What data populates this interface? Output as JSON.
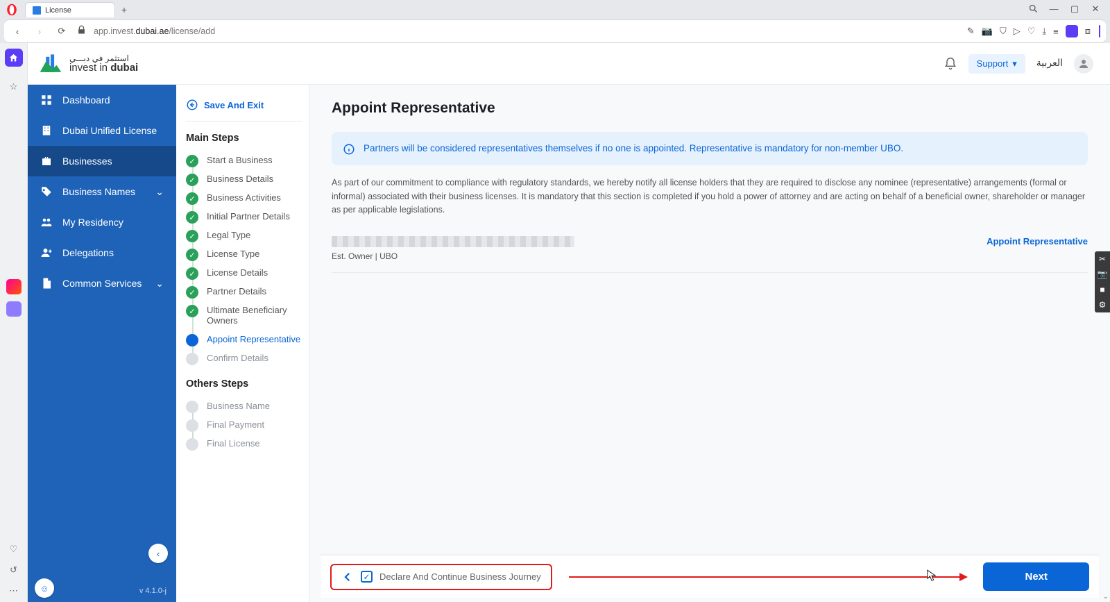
{
  "browser": {
    "tab_title": "License",
    "url_prefix": "app.invest.",
    "url_mid": "dubai.ae",
    "url_suffix": "/license/add"
  },
  "header": {
    "logo_ar": "استثمر في دبـــي",
    "logo_en_1": "invest in ",
    "logo_en_2": "dubai",
    "support": "Support",
    "language": "العربية"
  },
  "sidebar": {
    "items": [
      {
        "label": "Dashboard"
      },
      {
        "label": "Dubai Unified License"
      },
      {
        "label": "Businesses"
      },
      {
        "label": "Business Names"
      },
      {
        "label": "My Residency"
      },
      {
        "label": "Delegations"
      },
      {
        "label": "Common Services"
      }
    ],
    "version": "v 4.1.0-j"
  },
  "steps": {
    "save_exit": "Save And Exit",
    "main_heading": "Main Steps",
    "main": [
      "Start a Business",
      "Business Details",
      "Business Activities",
      "Initial Partner Details",
      "Legal Type",
      "License Type",
      "License Details",
      "Partner Details",
      "Ultimate Beneficiary Owners",
      "Appoint Representative",
      "Confirm Details"
    ],
    "main_states": [
      "done",
      "done",
      "done",
      "done",
      "done",
      "done",
      "done",
      "done",
      "done",
      "current",
      "pending"
    ],
    "others_heading": "Others Steps",
    "others": [
      "Business Name",
      "Final Payment",
      "Final License"
    ]
  },
  "content": {
    "title": "Appoint Representative",
    "banner": "Partners will be considered representatives themselves if no one is appointed. Representative is mandatory for non-member UBO.",
    "disclosure": "As part of our commitment to compliance with regulatory standards, we hereby notify all license holders that they are required to disclose any nominee (representative) arrangements (formal or informal) associated with their business licenses. It is mandatory that this section is completed if you hold a power of attorney and are acting on behalf of a beneficial owner, shareholder or manager as per applicable legislations.",
    "partner_role": "Est. Owner | UBO",
    "appoint_link": "Appoint Representative",
    "declare": "Declare And Continue Business Journey",
    "next": "Next"
  }
}
